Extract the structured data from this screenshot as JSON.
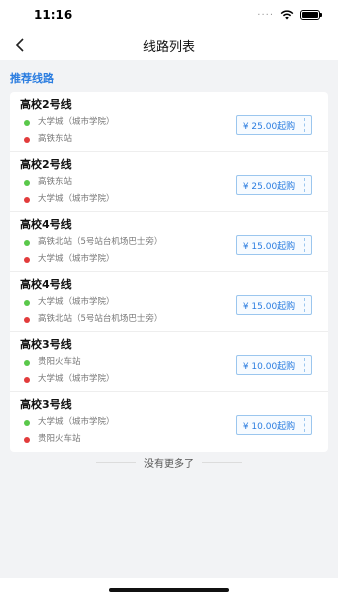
{
  "status_bar": {
    "time": "11:16",
    "dots": "····"
  },
  "nav": {
    "title": "线路列表"
  },
  "section": {
    "label": "推荐线路"
  },
  "routes": [
    {
      "name": "高校2号线",
      "from": "大学城（城市学院）",
      "to": "高铁东站",
      "price": "¥ 25.00起购"
    },
    {
      "name": "高校2号线",
      "from": "高铁东站",
      "to": "大学城（城市学院）",
      "price": "¥ 25.00起购"
    },
    {
      "name": "高校4号线",
      "from": "高铁北站（5号站台机场巴士旁）",
      "to": "大学城（城市学院）",
      "price": "¥ 15.00起购"
    },
    {
      "name": "高校4号线",
      "from": "大学城（城市学院）",
      "to": "高铁北站（5号站台机场巴士旁）",
      "price": "¥ 15.00起购"
    },
    {
      "name": "高校3号线",
      "from": "贵阳火车站",
      "to": "大学城（城市学院）",
      "price": "¥ 10.00起购"
    },
    {
      "name": "高校3号线",
      "from": "大学城（城市学院）",
      "to": "贵阳火车站",
      "price": "¥ 10.00起购"
    }
  ],
  "footer": {
    "no_more": "没有更多了"
  },
  "colors": {
    "accent": "#2b7de0",
    "start_dot": "#59c84a",
    "end_dot": "#e23b3b"
  },
  "icons": {
    "back": "chevron-left-icon",
    "wifi": "wifi-icon",
    "battery": "battery-icon"
  }
}
